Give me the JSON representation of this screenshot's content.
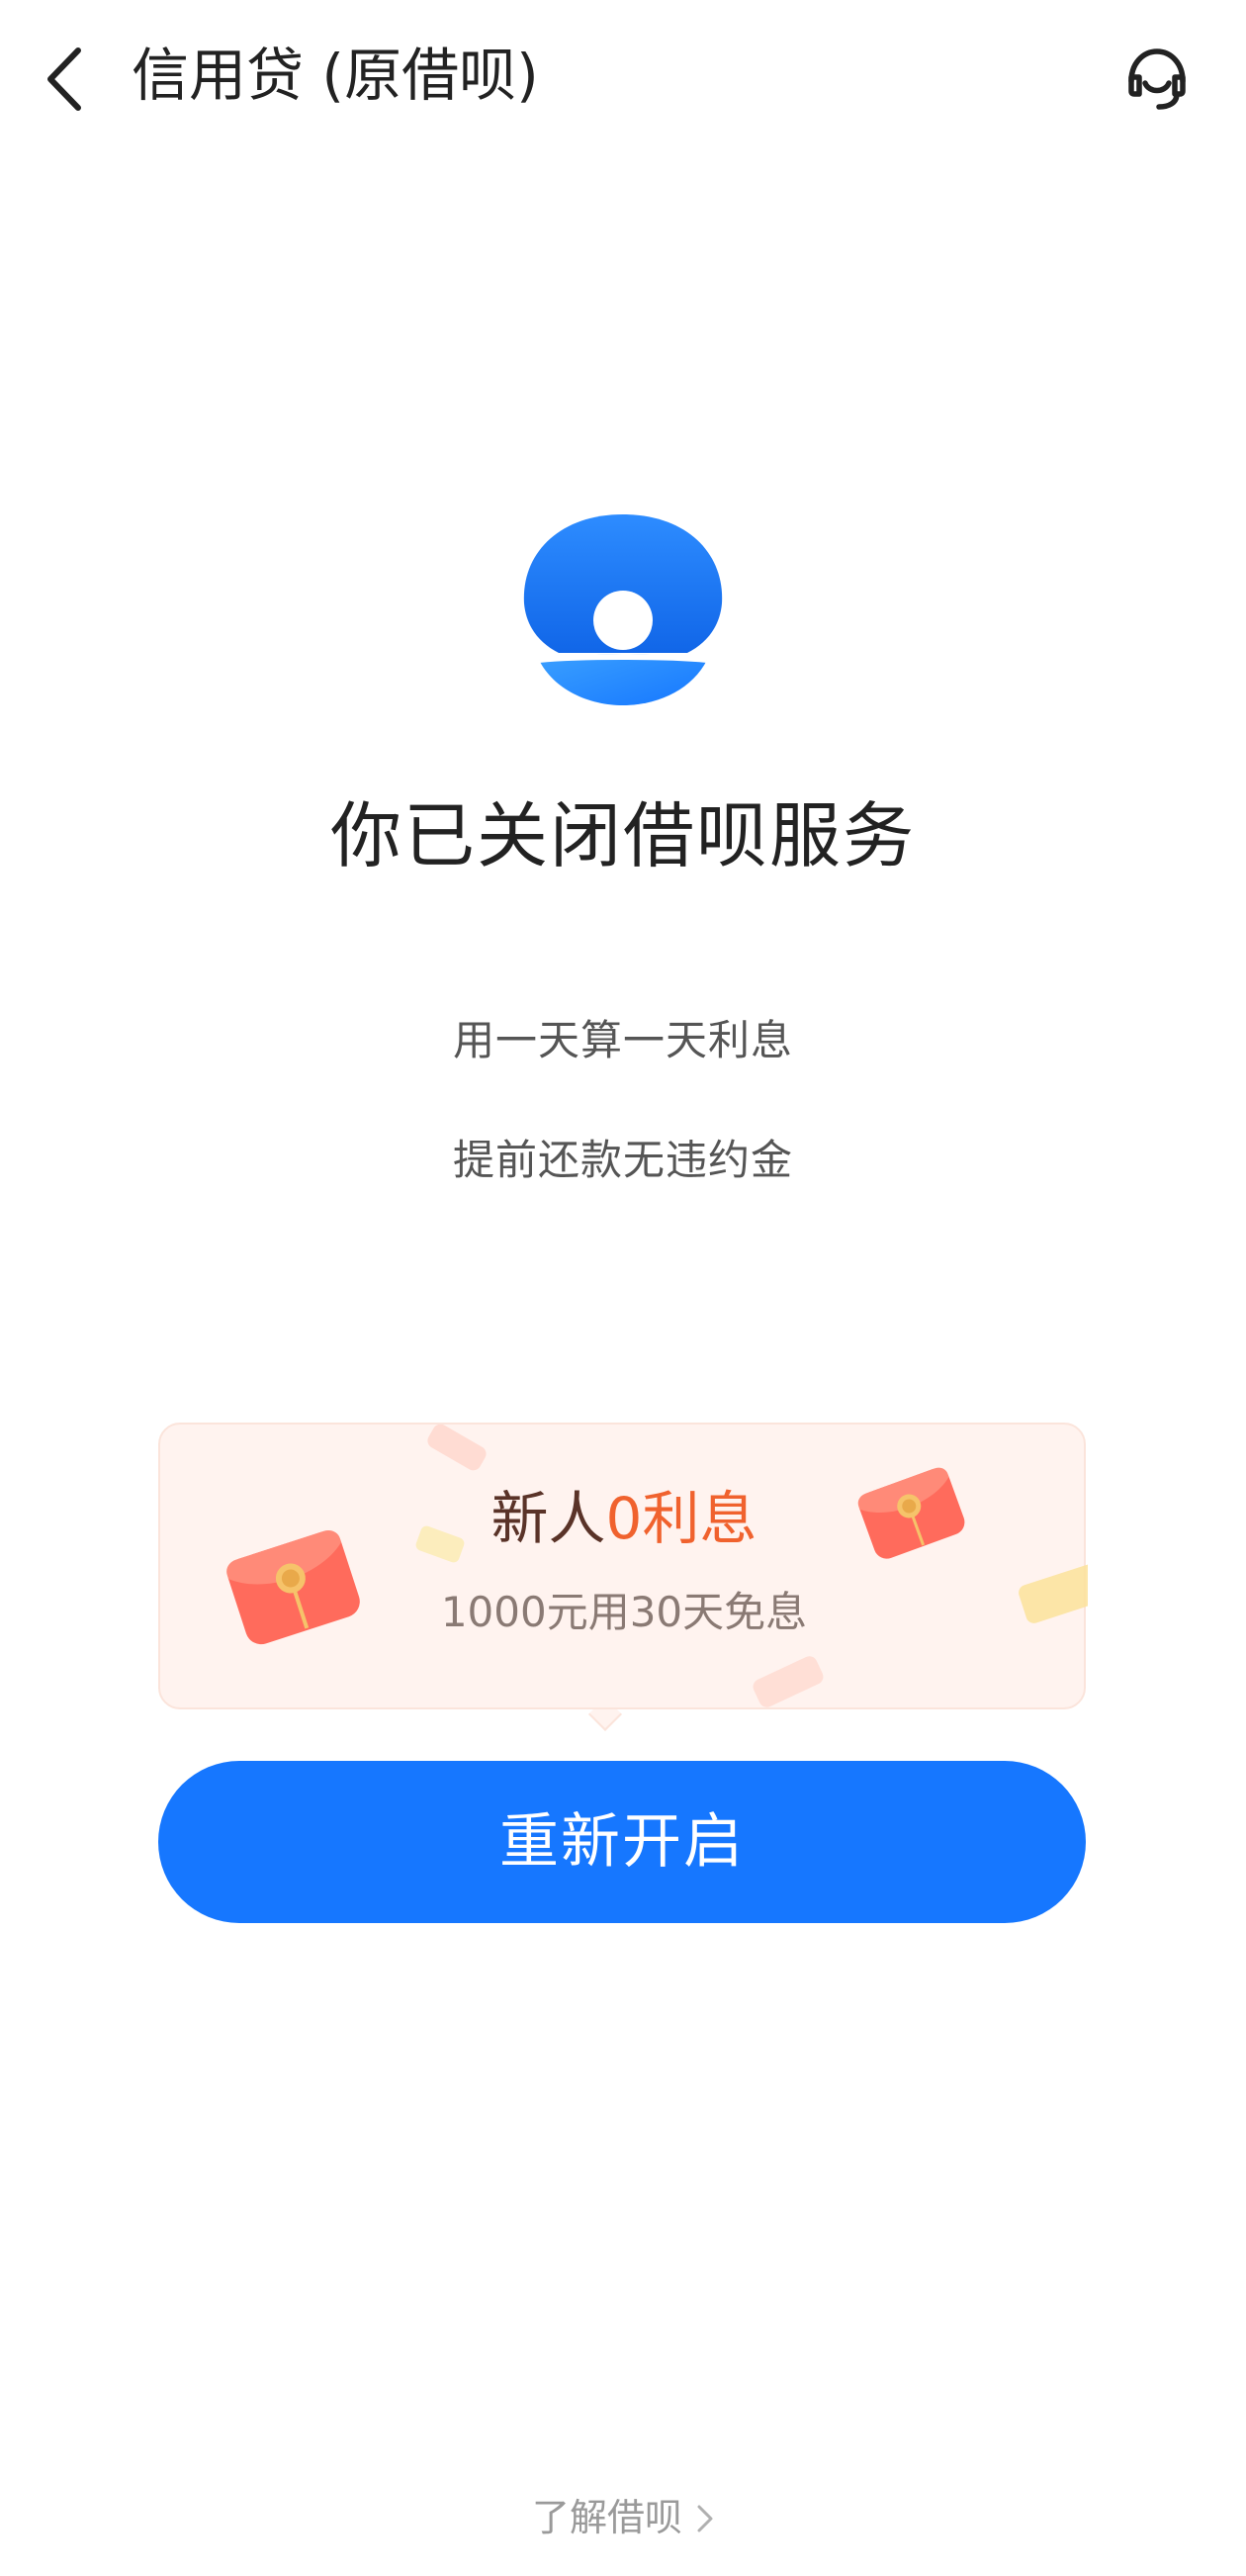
{
  "header": {
    "title": "信用贷 (原借呗)",
    "back_icon": "chevron-left-icon",
    "service_icon": "headset-icon"
  },
  "logo": {
    "icon": "jiebei-logo-icon",
    "color": "#1677ff"
  },
  "status": {
    "title": "你已关闭借呗服务"
  },
  "features": [
    "用一天算一天利息",
    "提前还款无违约金"
  ],
  "promo": {
    "title_prefix": "新人",
    "title_highlight": "0利息",
    "subtitle": "1000元用30天免息",
    "highlight_color": "#f0622e",
    "icons": [
      "red-envelope-icon",
      "red-envelope-icon"
    ]
  },
  "primary_button": {
    "label": "重新开启",
    "color": "#1677ff"
  },
  "footer": {
    "link_label": "了解借呗",
    "link_icon": "chevron-right-icon"
  }
}
